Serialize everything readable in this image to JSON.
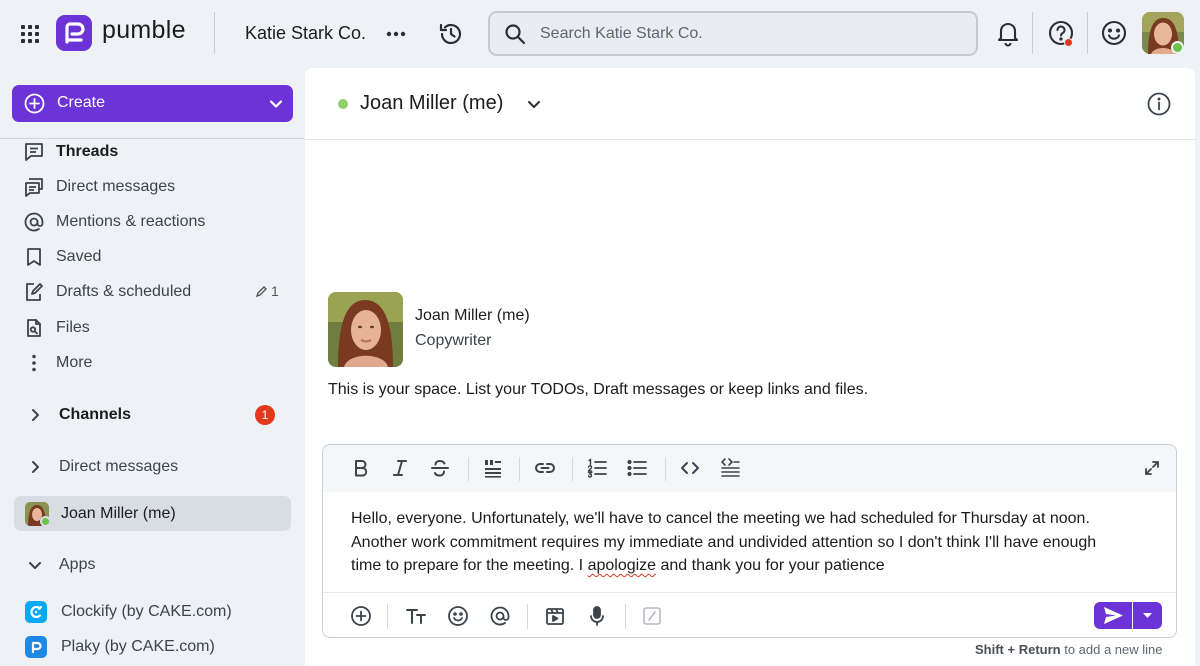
{
  "topbar": {
    "brand": "pumble",
    "workspace": "Katie Stark Co.",
    "search_placeholder": "Search Katie Stark Co."
  },
  "sidebar": {
    "create_label": "Create",
    "nav": [
      {
        "label": "Threads",
        "icon": "threads-icon"
      },
      {
        "label": "Direct messages",
        "icon": "direct-messages-icon"
      },
      {
        "label": "Mentions & reactions",
        "icon": "at-icon"
      },
      {
        "label": "Saved",
        "icon": "bookmark-icon"
      },
      {
        "label": "Drafts & scheduled",
        "icon": "draft-icon",
        "count": "1"
      },
      {
        "label": "Files",
        "icon": "files-icon"
      },
      {
        "label": "More",
        "icon": "more-vertical-icon"
      }
    ],
    "channels": {
      "label": "Channels",
      "badge": "1"
    },
    "direct_messages": {
      "label": "Direct messages"
    },
    "dm_user": "Joan Miller (me)",
    "apps": {
      "label": "Apps",
      "items": [
        {
          "label": "Clockify (by CAKE.com)",
          "color": "#03a9f4"
        },
        {
          "label": "Plaky (by CAKE.com)",
          "color": "#1e88e5"
        }
      ]
    }
  },
  "channel": {
    "title": "Joan Miller (me)",
    "status_color": "#8fcf6f"
  },
  "intro": {
    "name": "Joan Miller (me)",
    "role": "Copywriter",
    "text": "This is your space. List your TODOs, Draft messages or keep links and files."
  },
  "composer": {
    "line1": "Hello, everyone. Unfortunately, we'll have to cancel the meeting we had scheduled for Thursday at noon.",
    "line2": "Another work commitment requires my immediate and undivided attention so I don't think I'll have enough",
    "line3_pre": "time to prepare for the meeting. I ",
    "line3_typo": "apologize",
    "line3_post": " and thank you for your patience",
    "hint_key": "Shift + Return",
    "hint_text": " to add a new line"
  },
  "colors": {
    "accent": "#6c34d6",
    "badge": "#e2381c",
    "online": "#6cc24a"
  }
}
